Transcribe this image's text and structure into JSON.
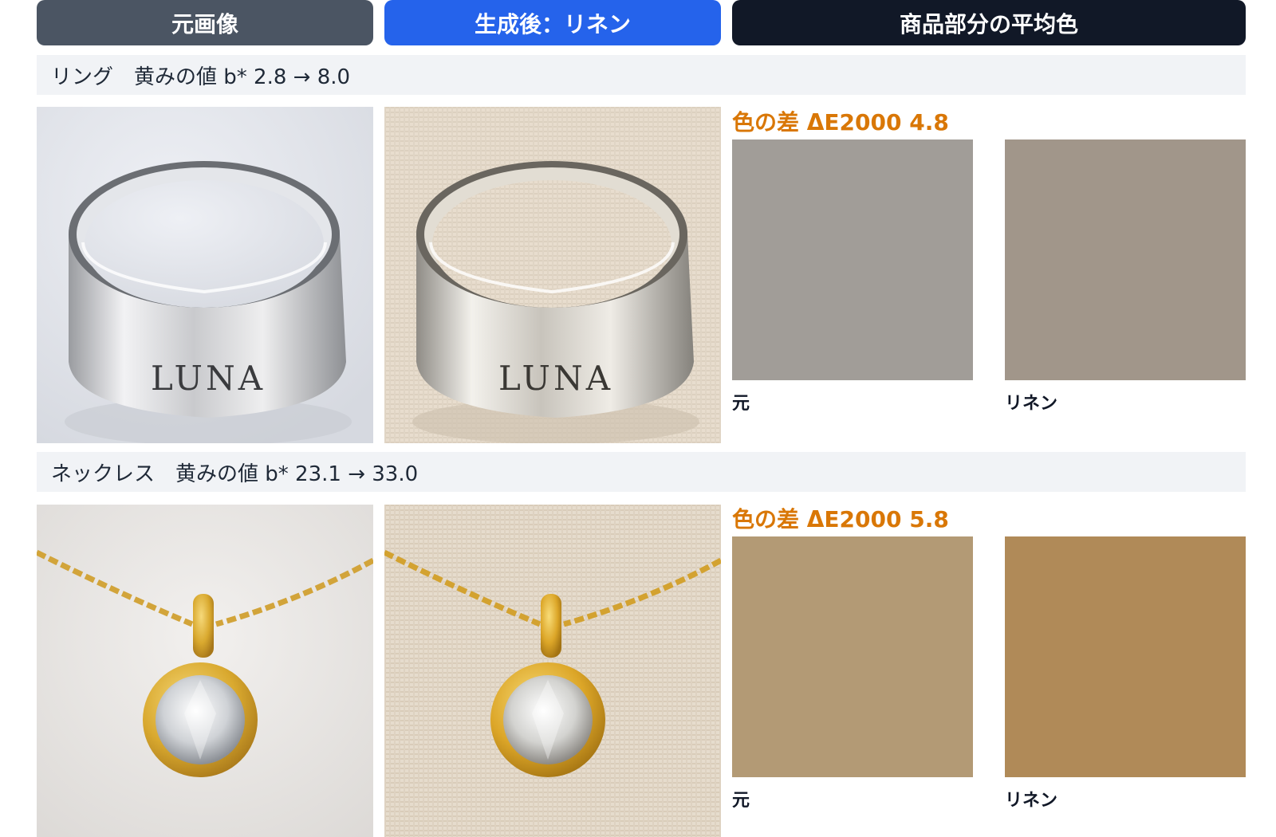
{
  "headers": {
    "original": "元画像",
    "generated": "生成後：リネン",
    "average": "商品部分の平均色"
  },
  "rows": [
    {
      "label": "リング　黄みの値 b* 2.8 → 8.0",
      "delta": "色の差 ΔE2000 4.8",
      "engraving": "LUNA",
      "swatch_original": {
        "caption": "元",
        "color": "#a19d98"
      },
      "swatch_linen": {
        "caption": "リネン",
        "color": "#a1968a"
      }
    },
    {
      "label": "ネックレス　黄みの値 b* 23.1 → 33.0",
      "delta": "色の差 ΔE2000 5.8",
      "swatch_original": {
        "caption": "元",
        "color": "#b39a75"
      },
      "swatch_linen": {
        "caption": "リネン",
        "color": "#b08a58"
      }
    }
  ]
}
